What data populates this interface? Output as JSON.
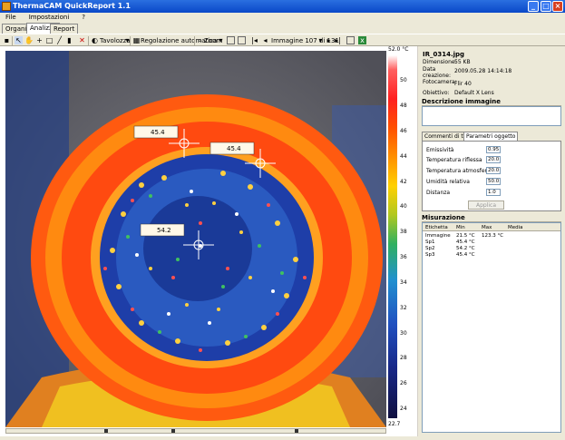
{
  "window": {
    "title": "ThermaCAM QuickReport 1.1"
  },
  "menu": [
    "File",
    "Impostazioni",
    "?"
  ],
  "tabs": [
    "Organizza",
    "Analizza",
    "Report"
  ],
  "toolbar": {
    "tavolozza": "Tavolozza",
    "regolazione": "Regolazione automatica",
    "zoom": "Zoom",
    "image_counter": "Immagine 107 di 131"
  },
  "scale": {
    "max": "52.0 °C",
    "min": "22.7",
    "ticks": [
      "50",
      "48",
      "46",
      "44",
      "42",
      "40",
      "38",
      "36",
      "34",
      "32",
      "30",
      "28",
      "26",
      "24"
    ]
  },
  "spots": [
    {
      "label": "45.4"
    },
    {
      "label": "45.4"
    },
    {
      "label": "54.2"
    }
  ],
  "info": {
    "filename": "IR_0314.jpg",
    "rows": [
      {
        "key": "Dimensione:",
        "value": "55 KB"
      },
      {
        "key": "Data creazione:",
        "value": "2009.05.28 14:14:18"
      },
      {
        "key": "Fotocamera:",
        "value": "Flir 40"
      },
      {
        "key": "Obiettivo:",
        "value": "Default X Lens"
      }
    ]
  },
  "description": {
    "title": "Descrizione immagine",
    "value": ""
  },
  "params": {
    "tabs": [
      "Commenti di testo",
      "Parametri oggetto"
    ],
    "fields": [
      {
        "label": "Emissività",
        "value": "0.95"
      },
      {
        "label": "Temperatura riflessa",
        "value": "20.0"
      },
      {
        "label": "Temperatura atmosferica",
        "value": "20.0"
      },
      {
        "label": "Umidità relativa",
        "value": "50.0"
      },
      {
        "label": "Distanza",
        "value": "1.0"
      }
    ],
    "apply": "Applica"
  },
  "measures": {
    "title": "Misurazione",
    "headers": [
      "Etichetta",
      "Min",
      "Max",
      "Media"
    ],
    "rows": [
      [
        "Immagine",
        "21.5 °C",
        "123.3 °C",
        ""
      ],
      [
        "Sp1",
        "45.4 °C",
        "",
        ""
      ],
      [
        "Sp2",
        "54.2 °C",
        "",
        ""
      ],
      [
        "Sp3",
        "45.4 °C",
        "",
        ""
      ]
    ]
  }
}
